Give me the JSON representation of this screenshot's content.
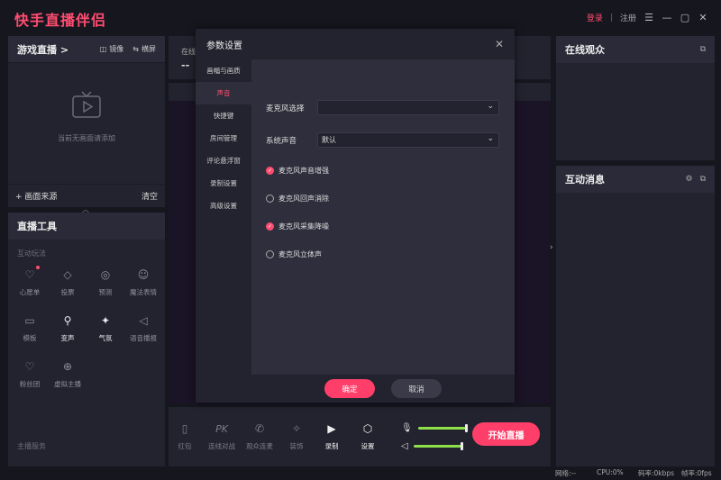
{
  "app": {
    "title": "快手直播伴侣",
    "login": "登录",
    "separator": "|",
    "register": "注册"
  },
  "scene": {
    "title": "游戏直播 >",
    "mirror": "镜像",
    "landscape": "横屏",
    "empty_text": "当前无画面请添加",
    "add_source": "+ 画面来源",
    "clear": "清空"
  },
  "tools": {
    "title": "直播工具",
    "section_interactive": "互动玩法",
    "section_services": "主播服务",
    "items": [
      {
        "label": "心愿单",
        "icon": "gift-box-icon"
      },
      {
        "label": "投票",
        "icon": "vote-icon"
      },
      {
        "label": "预测",
        "icon": "predict-icon"
      },
      {
        "label": "魔法表情",
        "icon": "magic-face-icon"
      },
      {
        "label": "模板",
        "icon": "template-icon"
      },
      {
        "label": "变声",
        "icon": "voice-change-icon"
      },
      {
        "label": "气氛",
        "icon": "party-icon"
      },
      {
        "label": "语音播报",
        "icon": "speaker-icon"
      },
      {
        "label": "粉丝团",
        "icon": "heart-icon"
      },
      {
        "label": "虚拟主播",
        "icon": "virtual-host-icon"
      }
    ]
  },
  "center": {
    "label": "在线",
    "value": "--"
  },
  "bottom": {
    "items": [
      {
        "label": "红包",
        "icon": "red-packet-icon"
      },
      {
        "label": "连线对战",
        "icon": "pk-icon"
      },
      {
        "label": "观众连麦",
        "icon": "phone-icon"
      },
      {
        "label": "装饰",
        "icon": "decorate-icon"
      },
      {
        "label": "录制",
        "icon": "record-icon"
      },
      {
        "label": "设置",
        "icon": "settings-icon"
      }
    ],
    "mic_level": 0.95,
    "speaker_level": 0.95,
    "start": "开始直播"
  },
  "right": {
    "online_title": "在线观众",
    "messages_title": "互动消息"
  },
  "status": {
    "network": "网络:--",
    "cpu": "CPU:0%",
    "bitrate": "码率:0kbps",
    "fps": "帧率:0fps"
  },
  "modal": {
    "title": "参数设置",
    "nav": [
      "画幅与画质",
      "声音",
      "快捷键",
      "房间管理",
      "评论悬浮窗",
      "录制设置",
      "高级设置"
    ],
    "active_nav": 1,
    "mic_label": "麦克风选择",
    "mic_value": "",
    "system_sound_label": "系统声音",
    "system_sound_value": "默认",
    "checks": [
      {
        "label": "麦克风声音增强",
        "checked": true
      },
      {
        "label": "麦克风回声消除",
        "checked": false
      },
      {
        "label": "麦克风采集降噪",
        "checked": true
      },
      {
        "label": "麦克风立体声",
        "checked": false
      }
    ],
    "ok": "确定",
    "cancel": "取消"
  }
}
